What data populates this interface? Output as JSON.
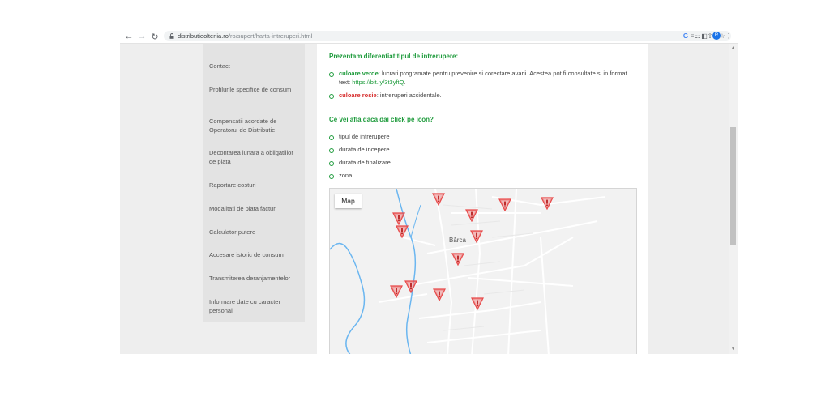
{
  "browser": {
    "url_domain": "distributieoltenia.ro",
    "url_path": "/ro/suport/harta-intreruperi.html",
    "avatar_letter": "R"
  },
  "sidebar": {
    "items": [
      {
        "label": "Contact"
      },
      {
        "label": "Profilurile specifice de consum"
      },
      {
        "label": "Compensatii acordate de Operatorul de Distributie"
      },
      {
        "label": "Decontarea lunara a obligatiilor de plata"
      },
      {
        "label": "Raportare costuri"
      },
      {
        "label": "Modalitati de plata facturi"
      },
      {
        "label": "Calculator putere"
      },
      {
        "label": "Accesare istoric de consum"
      },
      {
        "label": "Transmiterea deranjamentelor"
      },
      {
        "label": "Informare date cu caracter personal"
      }
    ]
  },
  "content": {
    "heading1": "Prezentam diferentiat tipul de intrerupere:",
    "legend_green_label": "culoare verde",
    "legend_green_text": ": lucrari programate pentru prevenire si corectare avarii. Acestea pot fi consultate si in format text: ",
    "legend_green_link": "https://bit.ly/3t3yftQ",
    "legend_green_end": ".",
    "legend_red_label": "culoare rosie",
    "legend_red_text": ": intreruperi accidentale.",
    "heading2": "Ce vei afla daca dai click pe icon?",
    "info_items": [
      "tipul de intrerupere",
      "durata de incepere",
      "durata de finalizare",
      "zona"
    ]
  },
  "map": {
    "button_label": "Map",
    "town_label": "Bârca",
    "marker_color": "#e84a4a",
    "marker_count": 12
  },
  "colors": {
    "accent_green": "#1e9b3c",
    "accent_red": "#d62a2a"
  }
}
